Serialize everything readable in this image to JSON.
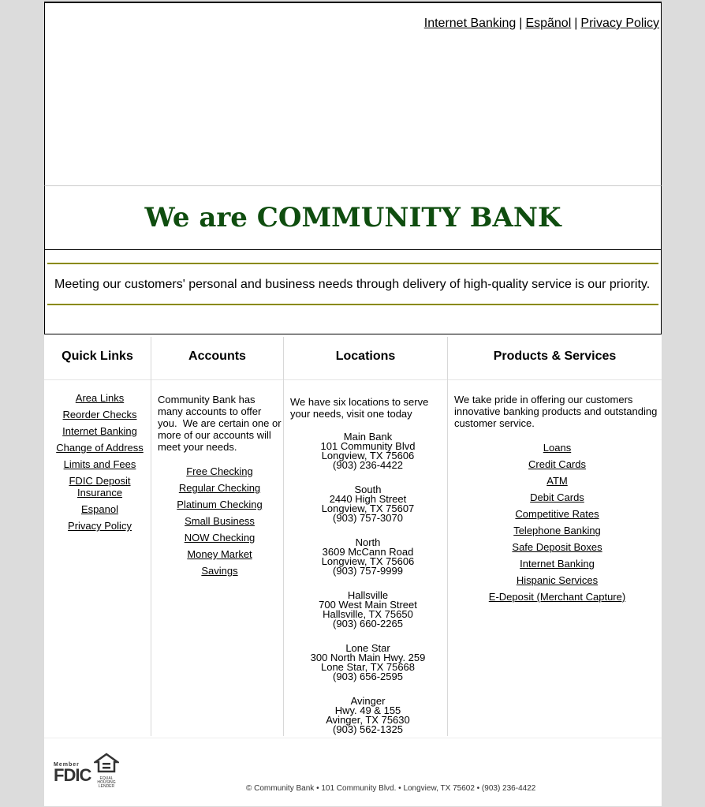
{
  "top_links": {
    "internet_banking": "Internet Banking",
    "espanol": "Espãnol",
    "privacy_policy": "Privacy Policy",
    "separator": "|"
  },
  "title": "We are COMMUNITY BANK",
  "mission": "Meeting our customers' personal and business needs through delivery of high-quality service is our priority.",
  "colors": {
    "title_green": "#0f4d0f",
    "rule_olive": "#8a8a00"
  },
  "quick_links": {
    "heading": "Quick Links",
    "items": [
      "Area Links",
      "Reorder Checks",
      "Internet Banking",
      "Change of Address",
      "Limits and Fees",
      "FDIC Deposit Insurance",
      "Espanol",
      "Privacy Policy"
    ]
  },
  "accounts": {
    "heading": "Accounts",
    "intro": "Community Bank has many accounts to offer you.  We are certain one or more of our accounts will meet your needs.",
    "items": [
      "Free Checking",
      "Regular Checking",
      "Platinum Checking",
      "Small Business",
      "NOW Checking",
      "Money Market",
      "Savings"
    ]
  },
  "locations": {
    "heading": "Locations",
    "intro": "We have six locations to serve your needs, visit one today",
    "items": [
      {
        "name": "Main Bank",
        "street": "101 Community Blvd",
        "city": "Longview, TX 75606",
        "phone": "(903) 236-4422"
      },
      {
        "name": "South",
        "street": "2440 High Street",
        "city": "Longview, TX 75607",
        "phone": "(903) 757-3070"
      },
      {
        "name": "North",
        "street": "3609 McCann Road",
        "city": "Longview, TX 75606",
        "phone": "(903) 757-9999"
      },
      {
        "name": "Hallsville",
        "street": "700 West Main Street",
        "city": "Hallsville, TX 75650",
        "phone": "(903) 660-2265"
      },
      {
        "name": "Lone Star",
        "street": "300 North Main Hwy. 259",
        "city": "Lone Star, TX 75668",
        "phone": "(903) 656-2595"
      },
      {
        "name": "Avinger",
        "street": "Hwy. 49 & 155",
        "city": "Avinger, TX 75630",
        "phone": "(903) 562-1325"
      }
    ]
  },
  "products": {
    "heading": "Products & Services",
    "intro": "We take pride in offering our customers innovative banking products and outstanding customer service.",
    "items": [
      "Loans",
      "Credit Cards",
      "ATM",
      "Debit Cards",
      "Competitive Rates",
      "Telephone Banking",
      "Safe Deposit Boxes",
      "Internet Banking",
      "Hispanic Services",
      "E-Deposit (Merchant Capture)"
    ]
  },
  "footer": {
    "fdic_member": "Member",
    "fdic": "FDIC",
    "ehl_text": "EQUAL HOUSING LENDER",
    "copyright": "© Community Bank • 101 Community Blvd. • Longview, TX 75602 • (903) 236-4422"
  }
}
